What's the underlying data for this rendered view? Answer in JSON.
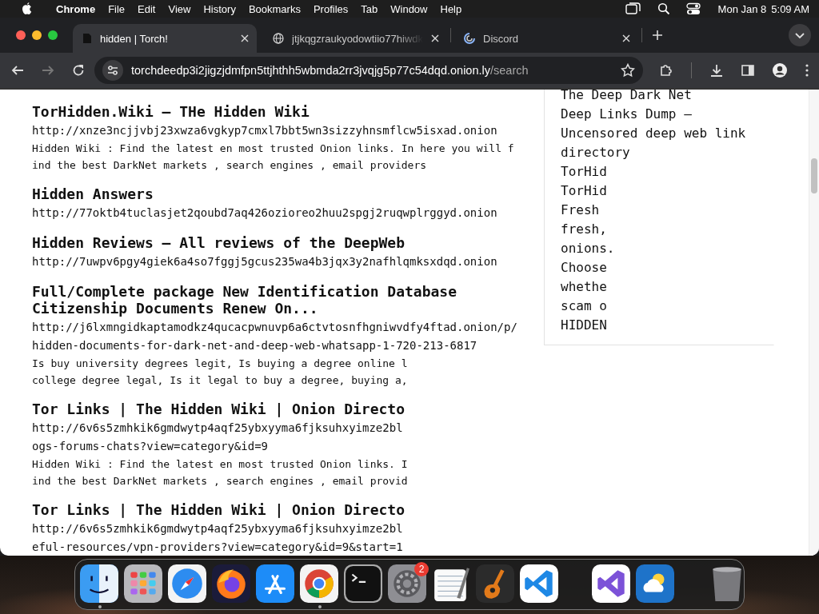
{
  "menu_bar": {
    "app": "Chrome",
    "items": [
      "File",
      "Edit",
      "View",
      "History",
      "Bookmarks",
      "Profiles",
      "Tab",
      "Window",
      "Help"
    ],
    "date": "Mon Jan 8",
    "time": "5:09 AM"
  },
  "tabs": [
    {
      "title": "hidden | Torch!",
      "selected": true,
      "kind": "page"
    },
    {
      "title": "jtjkqgzraukyodowtiio77hiwdk",
      "selected": false,
      "kind": "globe"
    },
    {
      "title": "Discord",
      "selected": false,
      "kind": "loading"
    }
  ],
  "address_bar": {
    "host": "torchdeedp3i2jigzjdmfpn5ttjhthh5wbmda2rr3jvqjg5p77c54dqd.onion.ly",
    "path": "/search"
  },
  "results": [
    {
      "title": "TorHidden.Wiki – THe Hidden Wiki",
      "url_lines": [
        "http://xnze3ncjjvbj23xwza6vgkyp7cmxl7bbt5wn3sizzyhnsmflcw5isxad.onion"
      ],
      "snippet_lines": [
        "Hidden Wiki : Find the latest en most trusted Onion links. In here you will f",
        "ind the best DarkNet markets , search engines , email providers"
      ]
    },
    {
      "title": "Hidden Answers",
      "url_lines": [
        "http://77oktb4tuclasjet2qoubd7aq426ozioreo2huu2spgj2ruqwplrggyd.onion"
      ]
    },
    {
      "title": "Hidden Reviews – All reviews of the DeepWeb",
      "url_lines": [
        "http://7uwpv6pgy4giek6a4so7fggj5gcus235wa4b3jqx3y2nafhlqmksxdqd.onion"
      ]
    },
    {
      "title": "Full/Complete package New Identification Database Citizenship Documents Renew On...",
      "url_lines": [
        "http://j6lxmngidkaptamodkz4qucacpwnuvp6a6ctvtosnfhgniwvdfy4ftad.onion/p/",
        "hidden-documents-for-dark-net-and-deep-web-whatsapp-1-720-213-6817"
      ],
      "snippet_lines": [
        "Is buy university degrees legit, Is buying a degree online l",
        "college degree legal, Is it legal to buy a degree, buying a,"
      ]
    },
    {
      "title": "Tor Links | The Hidden Wiki | Onion Directo",
      "url_lines": [
        "http://6v6s5zmhkik6gmdwytp4aqf25ybxyyma6fjksuhxyimze2bl",
        "ogs-forums-chats?view=category&id=9"
      ],
      "snippet_lines": [
        "Hidden Wiki : Find the latest en most trusted Onion links. I",
        "ind the best DarkNet markets , search engines , email provid"
      ]
    },
    {
      "title": "Tor Links | The Hidden Wiki | Onion Directo",
      "url_lines": [
        "http://6v6s5zmhkik6gmdwytp4aqf25ybxyyma6fjksuhxyimze2bl",
        "eful-resources/vpn-providers?view=category&id=9&start=1"
      ]
    }
  ],
  "sidebar_lines": [
    "The Deep Dark Net",
    "Deep Links Dump –",
    "Uncensored deep web link",
    "directory",
    "TorHid",
    "TorHid",
    "Fresh",
    "fresh,",
    "onions.",
    "Choose",
    "whethe",
    "scam o",
    "HIDDEN"
  ],
  "dock": [
    {
      "kind": "finder",
      "running": true
    },
    {
      "kind": "launchpad",
      "running": false
    },
    {
      "kind": "safari",
      "running": false
    },
    {
      "kind": "firefox",
      "running": false
    },
    {
      "kind": "appstore",
      "running": false
    },
    {
      "kind": "chrome",
      "running": true
    },
    {
      "kind": "terminal",
      "running": false
    },
    {
      "kind": "settings",
      "running": false,
      "badge": "2"
    },
    {
      "kind": "textedit",
      "running": false
    },
    {
      "kind": "guitar",
      "running": false
    },
    {
      "kind": "vscode",
      "running": false
    },
    {
      "kind": "separator"
    },
    {
      "kind": "visualstudio",
      "running": false
    },
    {
      "kind": "weather",
      "running": false
    },
    {
      "kind": "separator"
    },
    {
      "kind": "trash",
      "running": false
    }
  ]
}
